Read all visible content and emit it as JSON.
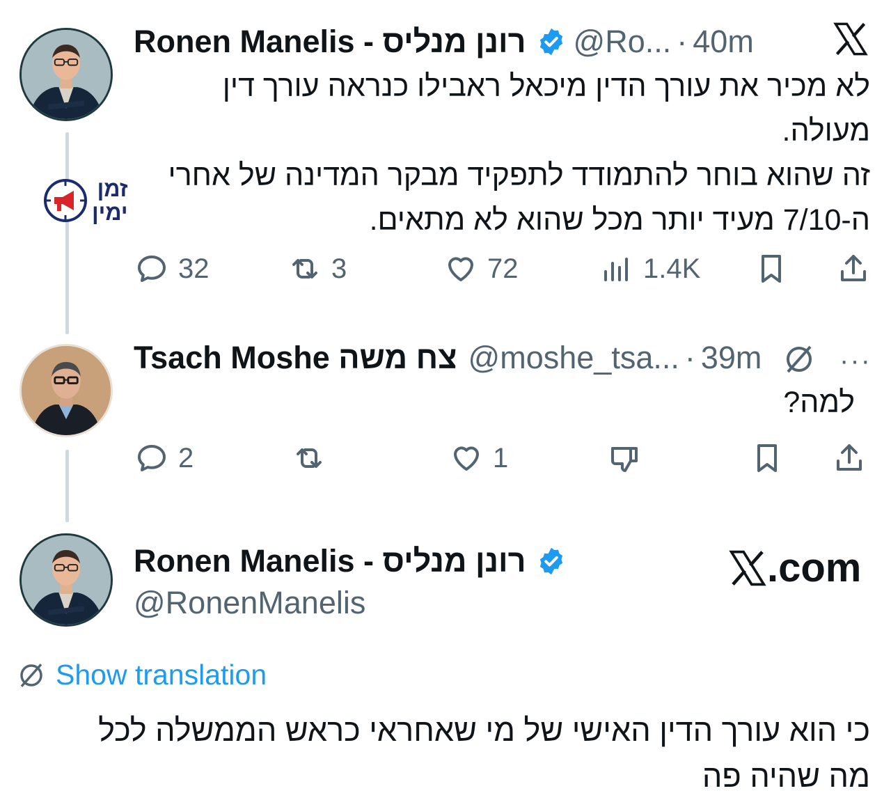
{
  "tweet1": {
    "name": "Ronen Manelis - רונן מנליס",
    "handle": "@Ro...",
    "time": "40m",
    "text_lines": [
      "לא מכיר את עורך הדין מיכאל ראבילו כנראה עורך דין",
      "מעולה.",
      "זה שהוא בוחר להתמודד לתפקיד מבקר המדינה של אחרי",
      "ה-7/10 מעיד יותר מכל שהוא לא מתאים."
    ],
    "replies": "32",
    "reposts": "3",
    "likes": "72",
    "views": "1.4K",
    "badge_line1": "זמן",
    "badge_line2": "ימין"
  },
  "tweet2": {
    "name": "Tsach Moshe צח משה",
    "handle": "@moshe_tsa...",
    "time": "39m",
    "text": "למה?",
    "replies": "2",
    "reposts": "",
    "likes": "1"
  },
  "tweet3": {
    "name": "Ronen Manelis - רונן מנליס",
    "handle": "@RonenManelis",
    "site": ".com",
    "translation_label": "Show translation",
    "text_lines": [
      "כי הוא עורך הדין האישי של מי שאחראי כראש הממשלה לכל",
      "מה שהיה פה"
    ]
  },
  "colors": {
    "verified": "#1d9bf0",
    "link": "#1d9bf0",
    "muted": "#536471",
    "thread_line": "#cfd9de"
  }
}
